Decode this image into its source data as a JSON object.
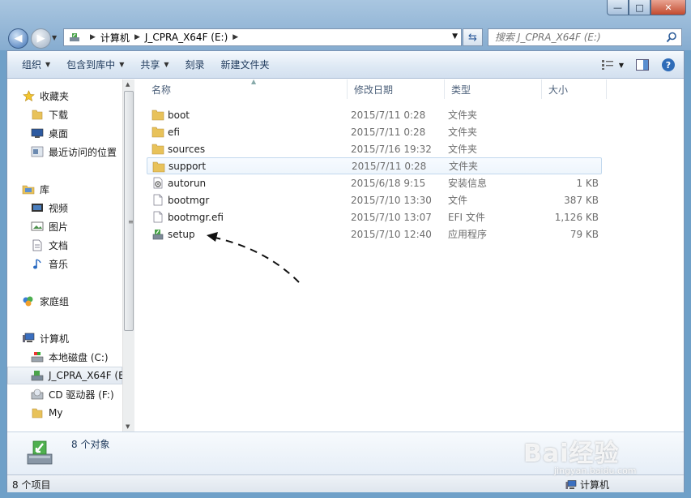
{
  "address": {
    "crumbs": [
      "计算机",
      "J_CPRA_X64F (E:)"
    ]
  },
  "search": {
    "placeholder": "搜索 J_CPRA_X64F (E:)"
  },
  "window_buttons": {
    "minimize": "—",
    "maximize": "□",
    "close": "✕"
  },
  "toolbar": {
    "organize": "组织",
    "include_in_library": "包含到库中",
    "share": "共享",
    "burn": "刻录",
    "new_folder": "新建文件夹"
  },
  "nav": {
    "favorites": "收藏夹",
    "downloads": "下载",
    "desktop": "桌面",
    "recent": "最近访问的位置",
    "libraries": "库",
    "videos": "视频",
    "pictures": "图片",
    "documents": "文档",
    "music": "音乐",
    "homegroup": "家庭组",
    "computer": "计算机",
    "local_disk": "本地磁盘 (C:)",
    "usb_drive": "J_CPRA_X64F (E",
    "cd_drive": "CD 驱动器 (F:)",
    "my": "My"
  },
  "columns": {
    "name": "名称",
    "date": "修改日期",
    "type": "类型",
    "size": "大小"
  },
  "files": [
    {
      "name": "boot",
      "date": "2015/7/11 0:28",
      "type": "文件夹",
      "size": "",
      "icon": "folder-icon"
    },
    {
      "name": "efi",
      "date": "2015/7/11 0:28",
      "type": "文件夹",
      "size": "",
      "icon": "folder-icon"
    },
    {
      "name": "sources",
      "date": "2015/7/16 19:32",
      "type": "文件夹",
      "size": "",
      "icon": "folder-icon"
    },
    {
      "name": "support",
      "date": "2015/7/11 0:28",
      "type": "文件夹",
      "size": "",
      "icon": "folder-icon"
    },
    {
      "name": "autorun",
      "date": "2015/6/18 9:15",
      "type": "安装信息",
      "size": "1 KB",
      "icon": "settings-file-icon"
    },
    {
      "name": "bootmgr",
      "date": "2015/7/10 13:30",
      "type": "文件",
      "size": "387 KB",
      "icon": "file-icon"
    },
    {
      "name": "bootmgr.efi",
      "date": "2015/7/10 13:07",
      "type": "EFI 文件",
      "size": "1,126 KB",
      "icon": "file-icon"
    },
    {
      "name": "setup",
      "date": "2015/7/10 12:40",
      "type": "应用程序",
      "size": "79 KB",
      "icon": "setup-app-icon"
    }
  ],
  "details": {
    "count": "8 个对象"
  },
  "status": {
    "items": "8 个项目",
    "location": "计算机"
  },
  "watermark": {
    "brand": "Bai经验",
    "url": "jingyan.baidu.com"
  },
  "colors": {
    "folder": "#e8c25a",
    "accent": "#3f72b5",
    "hover_border": "#c2d8ee"
  }
}
